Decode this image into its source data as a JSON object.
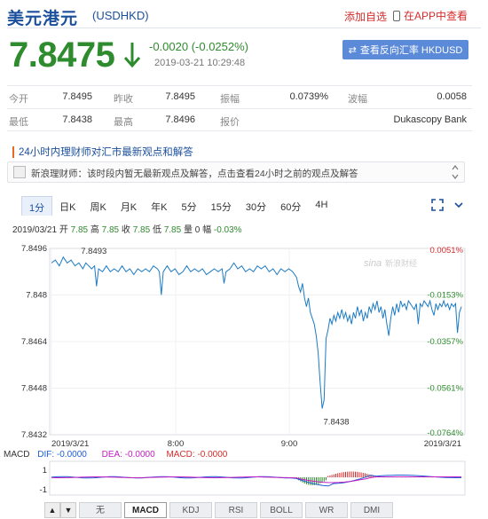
{
  "header": {
    "title": "美元港元",
    "code": "(USDHKD)",
    "watch_label": "添加自选",
    "app_label": "在APP中查看"
  },
  "quote": {
    "price": "7.8475",
    "change": "-0.0020 (-0.0252%)",
    "datetime": "2019-03-21  10:29:48",
    "reverse_label": "查看反向汇率 HKDUSD",
    "down_color": "#2e8b2e"
  },
  "stats": [
    {
      "label": "今开",
      "value": "7.8495"
    },
    {
      "label": "昨收",
      "value": "7.8495"
    },
    {
      "label": "振幅",
      "value": "0.0739%"
    },
    {
      "label": "波幅",
      "value": "0.0058"
    },
    {
      "label": "最低",
      "value": "7.8438"
    },
    {
      "label": "最高",
      "value": "7.8496"
    },
    {
      "label": "报价",
      "value": "Dukascopy Bank"
    }
  ],
  "news": {
    "title": "24小时内理财师对汇市最新观点和解答",
    "text": "新浪理财师：该时段内暂无最新观点及解答，点击查看24小时之前的观点及解答"
  },
  "tabs": [
    "1分",
    "日K",
    "周K",
    "月K",
    "年K",
    "5分",
    "15分",
    "30分",
    "60分",
    "4H"
  ],
  "active_tab": "1分",
  "ohlc": {
    "date": "2019/03/21",
    "open_label": "开",
    "open": "7.85",
    "high_label": "高",
    "high": "7.85",
    "close_label": "收",
    "close": "7.85",
    "low_label": "低",
    "low": "7.85",
    "vol_label": "量",
    "vol": "0",
    "amp_label": "幅",
    "amp": "-0.03%"
  },
  "chart_data": {
    "type": "line",
    "title": "",
    "watermark": "新浪财经",
    "y_ticks": [
      "7.8496",
      "7.848",
      "7.8464",
      "7.8448",
      "7.8432"
    ],
    "ylim": [
      7.8432,
      7.8496
    ],
    "pct_ticks": [
      {
        "label": "0.0051%",
        "value": 7.8496,
        "color": "#d42c2c"
      },
      {
        "label": "-0.0153%",
        "value": 7.848,
        "color": "#2e8b2e"
      },
      {
        "label": "-0.0357%",
        "value": 7.8464,
        "color": "#2e8b2e"
      },
      {
        "label": "-0.0561%",
        "value": 7.8448,
        "color": "#2e8b2e"
      },
      {
        "label": "-0.0764%",
        "value": 7.8432,
        "color": "#2e8b2e"
      }
    ],
    "x_ticks": [
      "2019/3/21",
      "8:00",
      "9:00",
      "2019/3/21"
    ],
    "high_annotation": "7.8493",
    "low_annotation": "7.8438",
    "series": [
      {
        "color": "#1c7bc4",
        "points": [
          [
            0,
            7.8491
          ],
          [
            4,
            7.8492
          ],
          [
            8,
            7.849
          ],
          [
            12,
            7.8493
          ],
          [
            16,
            7.8491
          ],
          [
            20,
            7.8492
          ],
          [
            24,
            7.849
          ],
          [
            28,
            7.8491
          ],
          [
            32,
            7.8489
          ],
          [
            35,
            7.8491
          ],
          [
            38,
            7.849
          ],
          [
            41,
            7.8489
          ],
          [
            44,
            7.849
          ],
          [
            46,
            7.8483
          ],
          [
            48,
            7.8489
          ],
          [
            52,
            7.8488
          ],
          [
            56,
            7.849
          ],
          [
            60,
            7.8488
          ],
          [
            64,
            7.8489
          ],
          [
            68,
            7.8488
          ],
          [
            72,
            7.849
          ],
          [
            76,
            7.8488
          ],
          [
            80,
            7.8489
          ],
          [
            84,
            7.8487
          ],
          [
            88,
            7.8489
          ],
          [
            92,
            7.8488
          ],
          [
            96,
            7.8489
          ],
          [
            100,
            7.8488
          ],
          [
            104,
            7.849
          ],
          [
            108,
            7.8489
          ],
          [
            110,
            7.8488
          ],
          [
            112,
            7.848
          ],
          [
            114,
            7.8488
          ],
          [
            118,
            7.849
          ],
          [
            122,
            7.8488
          ],
          [
            126,
            7.8489
          ],
          [
            130,
            7.8487
          ],
          [
            134,
            7.8488
          ],
          [
            138,
            7.849
          ],
          [
            142,
            7.8488
          ],
          [
            146,
            7.8489
          ],
          [
            150,
            7.8488
          ],
          [
            154,
            7.8489
          ],
          [
            158,
            7.8487
          ],
          [
            162,
            7.8488
          ],
          [
            166,
            7.8489
          ],
          [
            170,
            7.8488
          ],
          [
            174,
            7.8489
          ],
          [
            176,
            7.8484
          ],
          [
            178,
            7.8488
          ],
          [
            182,
            7.8489
          ],
          [
            186,
            7.8491
          ],
          [
            190,
            7.8489
          ],
          [
            194,
            7.849
          ],
          [
            198,
            7.8488
          ],
          [
            202,
            7.8489
          ],
          [
            206,
            7.8488
          ],
          [
            210,
            7.849
          ],
          [
            214,
            7.8489
          ],
          [
            218,
            7.849
          ],
          [
            222,
            7.8488
          ],
          [
            226,
            7.8489
          ],
          [
            230,
            7.8487
          ],
          [
            234,
            7.8489
          ],
          [
            238,
            7.8488
          ],
          [
            242,
            7.8489
          ],
          [
            246,
            7.8488
          ],
          [
            250,
            7.8486
          ],
          [
            252,
            7.8483
          ],
          [
            254,
            7.8481
          ],
          [
            256,
            7.8484
          ],
          [
            258,
            7.8479
          ],
          [
            260,
            7.8476
          ],
          [
            262,
            7.8479
          ],
          [
            264,
            7.8474
          ],
          [
            266,
            7.8472
          ],
          [
            268,
            7.847
          ],
          [
            270,
            7.8466
          ],
          [
            272,
            7.846
          ],
          [
            274,
            7.845
          ],
          [
            276,
            7.8441
          ],
          [
            278,
            7.8444
          ],
          [
            279,
            7.8455
          ],
          [
            280,
            7.8465
          ],
          [
            282,
            7.8468
          ],
          [
            284,
            7.8472
          ],
          [
            286,
            7.847
          ],
          [
            288,
            7.8473
          ],
          [
            290,
            7.8471
          ],
          [
            292,
            7.8474
          ],
          [
            294,
            7.8472
          ],
          [
            296,
            7.8475
          ],
          [
            298,
            7.8472
          ],
          [
            300,
            7.8474
          ],
          [
            302,
            7.8471
          ],
          [
            304,
            7.8473
          ],
          [
            306,
            7.847
          ],
          [
            308,
            7.8474
          ],
          [
            310,
            7.8472
          ],
          [
            312,
            7.8476
          ],
          [
            314,
            7.8473
          ],
          [
            316,
            7.8475
          ],
          [
            318,
            7.8471
          ],
          [
            320,
            7.8474
          ],
          [
            322,
            7.8472
          ],
          [
            324,
            7.8476
          ],
          [
            326,
            7.8474
          ],
          [
            328,
            7.8477
          ],
          [
            330,
            7.8475
          ],
          [
            332,
            7.8478
          ],
          [
            334,
            7.8474
          ],
          [
            336,
            7.8476
          ],
          [
            338,
            7.8472
          ],
          [
            340,
            7.8475
          ],
          [
            342,
            7.847
          ],
          [
            344,
            7.8466
          ],
          [
            346,
            7.8472
          ],
          [
            348,
            7.8476
          ],
          [
            350,
            7.8473
          ],
          [
            352,
            7.8477
          ],
          [
            354,
            7.8474
          ],
          [
            356,
            7.8478
          ],
          [
            358,
            7.8476
          ],
          [
            360,
            7.8477
          ],
          [
            362,
            7.8475
          ],
          [
            364,
            7.8478
          ],
          [
            366,
            7.8477
          ],
          [
            368,
            7.8476
          ],
          [
            370,
            7.8475
          ],
          [
            372,
            7.8477
          ],
          [
            374,
            7.847
          ],
          [
            376,
            7.8477
          ],
          [
            378,
            7.8476
          ],
          [
            380,
            7.8478
          ],
          [
            382,
            7.8477
          ],
          [
            384,
            7.8476
          ],
          [
            386,
            7.8478
          ],
          [
            388,
            7.8475
          ],
          [
            390,
            7.8473
          ],
          [
            392,
            7.8477
          ],
          [
            394,
            7.8475
          ],
          [
            396,
            7.8477
          ],
          [
            398,
            7.8476
          ],
          [
            400,
            7.8478
          ],
          [
            402,
            7.8476
          ],
          [
            404,
            7.8477
          ],
          [
            406,
            7.8475
          ],
          [
            408,
            7.8477
          ],
          [
            410,
            7.8476
          ],
          [
            412,
            7.8477
          ],
          [
            414,
            7.8467
          ],
          [
            416,
            7.8474
          ],
          [
            418,
            7.8476
          ]
        ]
      }
    ]
  },
  "macd": {
    "label": "MACD",
    "dif": "DIF: -0.0000",
    "dea": "DEA: -0.0000",
    "macd": "MACD: -0.0000",
    "y_ticks": [
      "1",
      "-1"
    ],
    "bars_x_start": 232,
    "bars_x_end": 318
  },
  "bottom_tabs": [
    "无",
    "MACD",
    "KDJ",
    "RSI",
    "BOLL",
    "WR",
    "DMI"
  ],
  "bottom_active": "MACD"
}
